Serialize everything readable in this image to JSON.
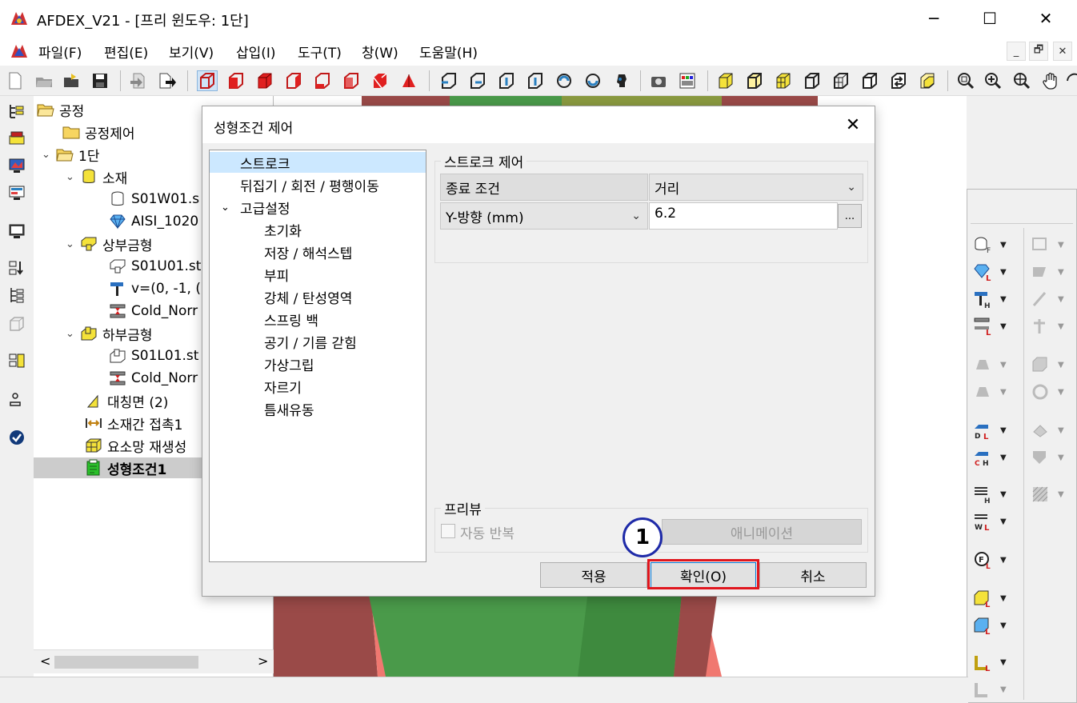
{
  "window": {
    "title": "AFDEX_V21 - [프리 윈도우: 1단]",
    "minimize": "─",
    "maximize": "☐",
    "close": "✕"
  },
  "menu": {
    "items": [
      "파일(F)",
      "편집(E)",
      "보기(V)",
      "삽입(I)",
      "도구(T)",
      "창(W)",
      "도움말(H)"
    ],
    "mdi": {
      "minimize": "_",
      "restore": "🗗",
      "close": "✕"
    }
  },
  "tree": {
    "nodes": [
      {
        "label": "공정",
        "icon": "folder-open-icon",
        "chev": ""
      },
      {
        "label": "공정제어",
        "icon": "folder-icon",
        "chev": ""
      },
      {
        "label": "1단",
        "icon": "folder-open-icon",
        "chev": "⌄"
      },
      {
        "label": "소재",
        "icon": "cylinder-icon",
        "chev": "⌄"
      },
      {
        "label": "S01W01.s",
        "icon": "cylinder-outline-icon",
        "chev": ""
      },
      {
        "label": "AISI_1020",
        "icon": "diamond-icon",
        "chev": ""
      },
      {
        "label": "상부금형",
        "icon": "upper-die-icon",
        "chev": "⌄"
      },
      {
        "label": "S01U01.st",
        "icon": "upper-die-outline-icon",
        "chev": ""
      },
      {
        "label": "v=(0, -1, (",
        "icon": "hammer-icon",
        "chev": ""
      },
      {
        "label": "Cold_Norr",
        "icon": "press-icon",
        "chev": ""
      },
      {
        "label": "하부금형",
        "icon": "lower-die-icon",
        "chev": "⌄"
      },
      {
        "label": "S01L01.st",
        "icon": "lower-die-outline-icon",
        "chev": ""
      },
      {
        "label": "Cold_Norr",
        "icon": "press-icon",
        "chev": ""
      },
      {
        "label": "대칭면 (2)",
        "icon": "symmetry-icon",
        "chev": ""
      },
      {
        "label": "소재간 접촉1",
        "icon": "contact-icon",
        "chev": ""
      },
      {
        "label": "요소망 재생성",
        "icon": "mesh-icon",
        "chev": ""
      },
      {
        "label": "성형조건1",
        "icon": "condition-icon",
        "chev": ""
      }
    ]
  },
  "dialog": {
    "title": "성형조건 제어",
    "close": "✕",
    "nav": [
      "스트로크",
      "뒤집기 / 회전 / 평행이동",
      "고급설정",
      "초기화",
      "저장 / 해석스텝",
      "부피",
      "강체 / 탄성영역",
      "스프링 백",
      "공기 / 기름 갇힘",
      "가상그립",
      "자르기",
      "틈새유동"
    ],
    "stroke_group": {
      "title": "스트로크 제어",
      "end_condition_label": "종료 조건",
      "end_condition_value": "거리",
      "direction_value": "Y-방향 (mm)",
      "distance_value": "6.2",
      "browse": "..."
    },
    "preview_group": {
      "title": "프리뷰",
      "auto_repeat": "자동 반복",
      "animation": "애니메이션"
    },
    "buttons": {
      "apply": "적용",
      "ok": "확인(O)",
      "cancel": "취소"
    },
    "callout": "1"
  },
  "colors": {
    "accent_red": "#e0161e",
    "callout_blue": "#1e2aa8",
    "nav_selected": "#cce8ff",
    "model_green": "#4a9a4a",
    "model_red": "#9a4a48"
  }
}
